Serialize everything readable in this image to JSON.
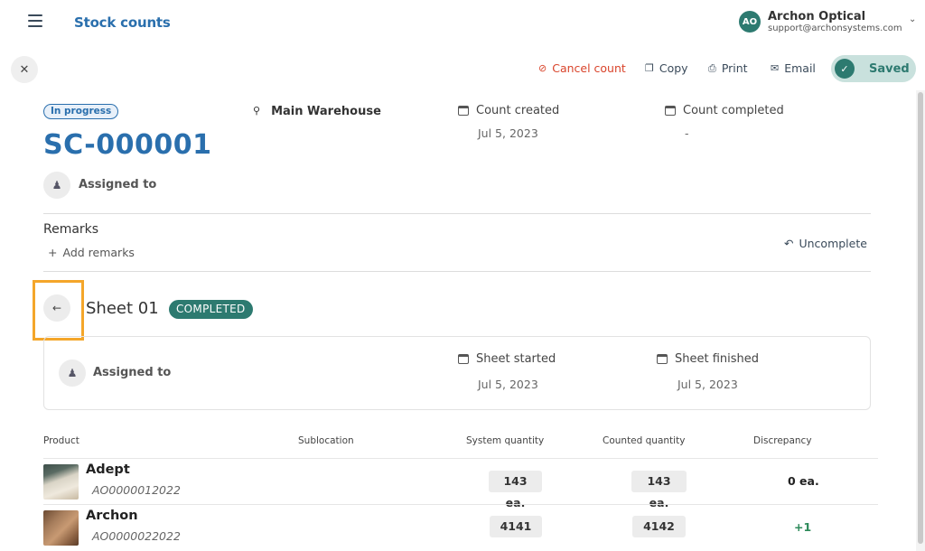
{
  "header": {
    "app_title": "Stock counts",
    "account": {
      "initials": "AO",
      "name": "Archon Optical",
      "email": "support@archonsystems.com"
    }
  },
  "actions": {
    "cancel": "Cancel count",
    "copy": "Copy",
    "print": "Print",
    "email": "Email",
    "saved": "Saved"
  },
  "count": {
    "status": "In progress",
    "id": "SC-000001",
    "location": "Main Warehouse",
    "created_label": "Count created",
    "created_value": "Jul 5, 2023",
    "completed_label": "Count completed",
    "completed_value": "-",
    "assigned_label": "Assigned to"
  },
  "remarks": {
    "title": "Remarks",
    "add": "Add remarks",
    "uncomplete": "Uncomplete"
  },
  "sheet": {
    "title": "Sheet 01",
    "status": "COMPLETED",
    "assigned_label": "Assigned to",
    "started_label": "Sheet started",
    "started_value": "Jul 5, 2023",
    "finished_label": "Sheet finished",
    "finished_value": "Jul 5, 2023"
  },
  "table": {
    "headers": [
      "Product",
      "Sublocation",
      "System quantity",
      "Counted quantity",
      "Discrepancy"
    ],
    "rows": [
      {
        "name": "Adept",
        "sku": "AO0000012022",
        "sublocation": "",
        "system_qty": "143 ea.",
        "counted_qty": "143 ea.",
        "discrepancy": "0 ea."
      },
      {
        "name": "Archon",
        "sku": "AO0000022022",
        "sublocation": "",
        "system_qty": "4141",
        "counted_qty": "4142",
        "discrepancy": "+1"
      }
    ]
  },
  "colors": {
    "brand_blue": "#2a6fad",
    "teal": "#2d7a70",
    "danger": "#d9442b",
    "positive": "#2d8a5a",
    "highlight": "#f4a62a"
  }
}
